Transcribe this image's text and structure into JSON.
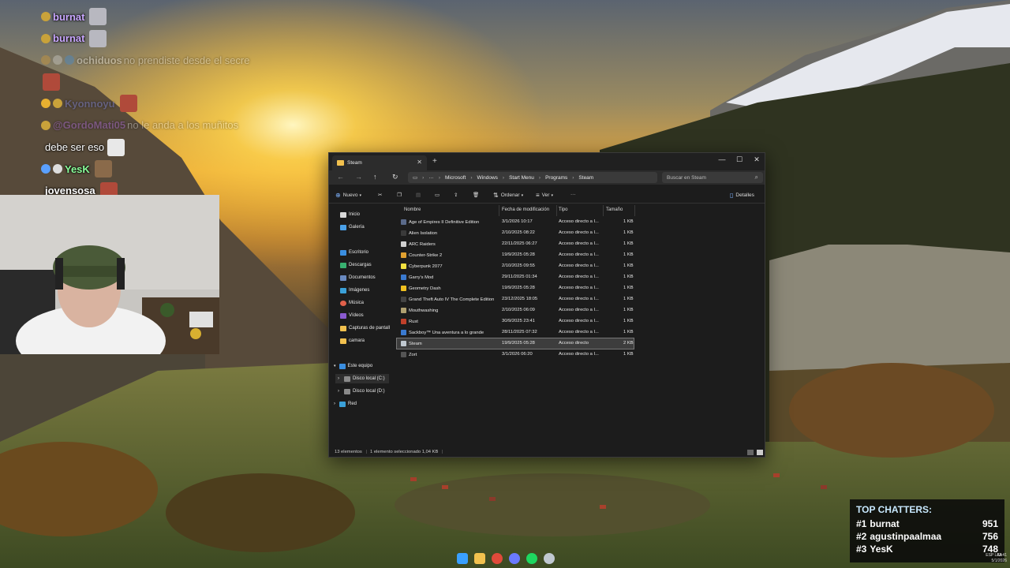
{
  "chat": {
    "messages": [
      {
        "user": "burnat",
        "message": "",
        "color": "#c9a7ff"
      },
      {
        "user": "burnat",
        "message": "",
        "color": "#c9a7ff"
      },
      {
        "user": "ochiduos",
        "message": "no prendiste desde el secre",
        "color": "#ffffff"
      },
      {
        "user": "",
        "message": "",
        "color": "#ffffff"
      },
      {
        "user": "Kyonnoyu",
        "message": "",
        "color": "#7f8cff"
      },
      {
        "user": "@GordoMati05",
        "message": "no le anda a los muñitos",
        "color": "#c070ff"
      },
      {
        "user": "",
        "message": "debe ser eso",
        "color": "#ffffff"
      },
      {
        "user": "YesK",
        "message": "",
        "color": "#8aff9a"
      },
      {
        "user": "jovensosa",
        "message": "",
        "color": "#ffffff"
      }
    ]
  },
  "top_chatters": {
    "title": "TOP CHATTERS:",
    "entries": [
      {
        "rank": "#1",
        "name": "burnat",
        "count": "951"
      },
      {
        "rank": "#2",
        "name": "agustinpaalmaa",
        "count": "756"
      },
      {
        "rank": "#3",
        "name": "YesK",
        "count": "748"
      }
    ]
  },
  "explorer": {
    "tab_title": "Steam",
    "breadcrumbs": [
      "Microsoft",
      "Windows",
      "Start Menu",
      "Programs",
      "Steam"
    ],
    "search_placeholder": "Buscar en Steam",
    "toolbar": {
      "new": "Nuevo",
      "sort": "Ordenar",
      "view": "Ver",
      "more": "···",
      "details": "Detalles"
    },
    "sidebar": {
      "quick": [
        "Inicio",
        "Galería"
      ],
      "pinned": [
        "Escritorio",
        "Descargas",
        "Documentos",
        "Imágenes",
        "Música",
        "Vídeos",
        "Capturas de pantall",
        "camara"
      ],
      "this_pc": "Este equipo",
      "drives": [
        "Disco local (C:)",
        "Disco local (D:)"
      ],
      "network": "Red"
    },
    "columns": {
      "name": "Nombre",
      "modified": "Fecha de modificación",
      "type": "Tipo",
      "size": "Tamaño"
    },
    "files": [
      {
        "name": "Age of Empires II Definitive Edition",
        "date": "3/1/2026 10:17",
        "type": "Acceso directo a I...",
        "size": "1 KB"
      },
      {
        "name": "Alien Isolation",
        "date": "2/10/2025 08:22",
        "type": "Acceso directo a I...",
        "size": "1 KB"
      },
      {
        "name": "ARC Raiders",
        "date": "22/11/2025 06:27",
        "type": "Acceso directo a I...",
        "size": "1 KB"
      },
      {
        "name": "Counter-Strike 2",
        "date": "19/9/2025 05:28",
        "type": "Acceso directo a I...",
        "size": "1 KB"
      },
      {
        "name": "Cyberpunk 2077",
        "date": "2/10/2025 09:55",
        "type": "Acceso directo a I...",
        "size": "1 KB"
      },
      {
        "name": "Garry's Mod",
        "date": "29/11/2025 01:34",
        "type": "Acceso directo a I...",
        "size": "1 KB"
      },
      {
        "name": "Geometry Dash",
        "date": "19/9/2025 05:28",
        "type": "Acceso directo a I...",
        "size": "1 KB"
      },
      {
        "name": "Grand Theft Auto IV The Complete Edition",
        "date": "23/12/2025 18:05",
        "type": "Acceso directo a I...",
        "size": "1 KB"
      },
      {
        "name": "Mouthwashing",
        "date": "2/10/2025 06:09",
        "type": "Acceso directo a I...",
        "size": "1 KB"
      },
      {
        "name": "Rust",
        "date": "30/9/2025 23:41",
        "type": "Acceso directo a I...",
        "size": "1 KB"
      },
      {
        "name": "Sackboy™ Una aventura a lo grande",
        "date": "28/11/2025 07:32",
        "type": "Acceso directo a I...",
        "size": "1 KB"
      },
      {
        "name": "Steam",
        "date": "19/9/2025 05:28",
        "type": "Acceso directo",
        "size": "2 KB"
      },
      {
        "name": "Zort",
        "date": "3/1/2026 06:20",
        "type": "Acceso directo a I...",
        "size": "1 KB"
      }
    ],
    "status": {
      "count": "13 elementos",
      "selected": "1 elemento seleccionado 1,04 KB"
    }
  },
  "taskbar": {
    "tray_lang": "ESP LAA",
    "time": "03:41",
    "date": "5/1/2026"
  }
}
